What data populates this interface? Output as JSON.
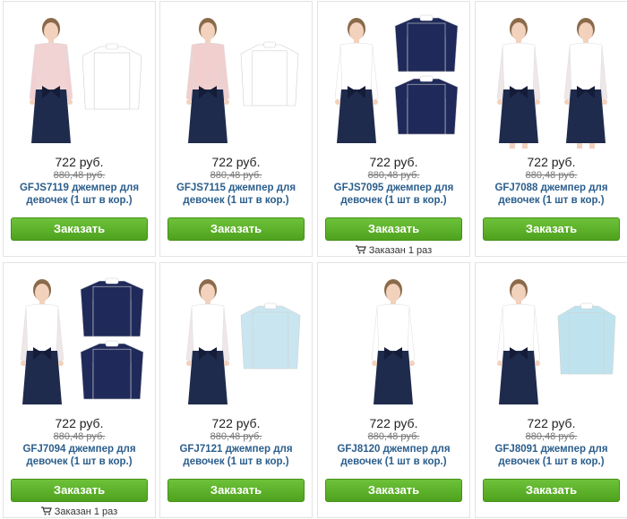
{
  "colors": {
    "accent": "#5cb125",
    "link": "#2b5e8c"
  },
  "products": [
    {
      "price": "722 руб.",
      "old_price": "880,48 руб.",
      "name": "GFJS7119 джемпер для девочек (1 шт в кор.)",
      "button": "Заказать",
      "ordered": "",
      "palette": {
        "top": "#f1d3d3",
        "sleeve": "#f3cfd2",
        "skirt": "#1e2b4d",
        "item": "#ffffff"
      }
    },
    {
      "price": "722 руб.",
      "old_price": "880,48 руб.",
      "name": "GFJS7115 джемпер для девочек (1 шт в кор.)",
      "button": "Заказать",
      "ordered": "",
      "palette": {
        "top": "#f1cfcf",
        "sleeve": "#f1cfcf",
        "skirt": "#1e2b4d",
        "item": "#ffffff"
      }
    },
    {
      "price": "722 руб.",
      "old_price": "880,48 руб.",
      "name": "GFJS7095 джемпер для девочек (1 шт в кор.)",
      "button": "Заказать",
      "ordered": "Заказан 1 раз",
      "palette": {
        "top": "#ffffff",
        "sleeve": "#ffffff",
        "skirt": "#1e2b4d",
        "item": "#1f2a5a"
      }
    },
    {
      "price": "722 руб.",
      "old_price": "880,48 руб.",
      "name": "GFJ7088 джемпер для девочек (1 шт в кор.)",
      "button": "Заказать",
      "ordered": "",
      "palette": {
        "top": "#ffffff",
        "sleeve": "#efe7e7",
        "skirt": "#1e2b4d",
        "item": "#ffffff"
      }
    },
    {
      "price": "722 руб.",
      "old_price": "880,48 руб.",
      "name": "GFJ7094 джемпер для девочек (1 шт в кор.)",
      "button": "Заказать",
      "ordered": "Заказан 1 раз",
      "palette": {
        "top": "#ffffff",
        "sleeve": "#efe7e7",
        "skirt": "#1e2b4d",
        "item": "#1f2a5a"
      }
    },
    {
      "price": "722 руб.",
      "old_price": "880,48 руб.",
      "name": "GFJ7121 джемпер для девочек (1 шт в кор.)",
      "button": "Заказать",
      "ordered": "",
      "palette": {
        "top": "#ffffff",
        "sleeve": "#efe7e7",
        "skirt": "#1e2b4d",
        "item": "#c9e6f0"
      }
    },
    {
      "price": "722 руб.",
      "old_price": "880,48 руб.",
      "name": "GFJ8120 джемпер для девочек (1 шт в кор.)",
      "button": "Заказать",
      "ordered": "",
      "palette": {
        "top": "#ffffff",
        "sleeve": "#ffffff",
        "skirt": "#1e2b4d",
        "item": ""
      }
    },
    {
      "price": "722 руб.",
      "old_price": "880,48 руб.",
      "name": "GFJ8091 джемпер для девочек (1 шт в кор.)",
      "button": "Заказать",
      "ordered": "",
      "palette": {
        "top": "#ffffff",
        "sleeve": "#ffffff",
        "skirt": "#1e2b4d",
        "item": "#bfe3ee"
      }
    }
  ]
}
